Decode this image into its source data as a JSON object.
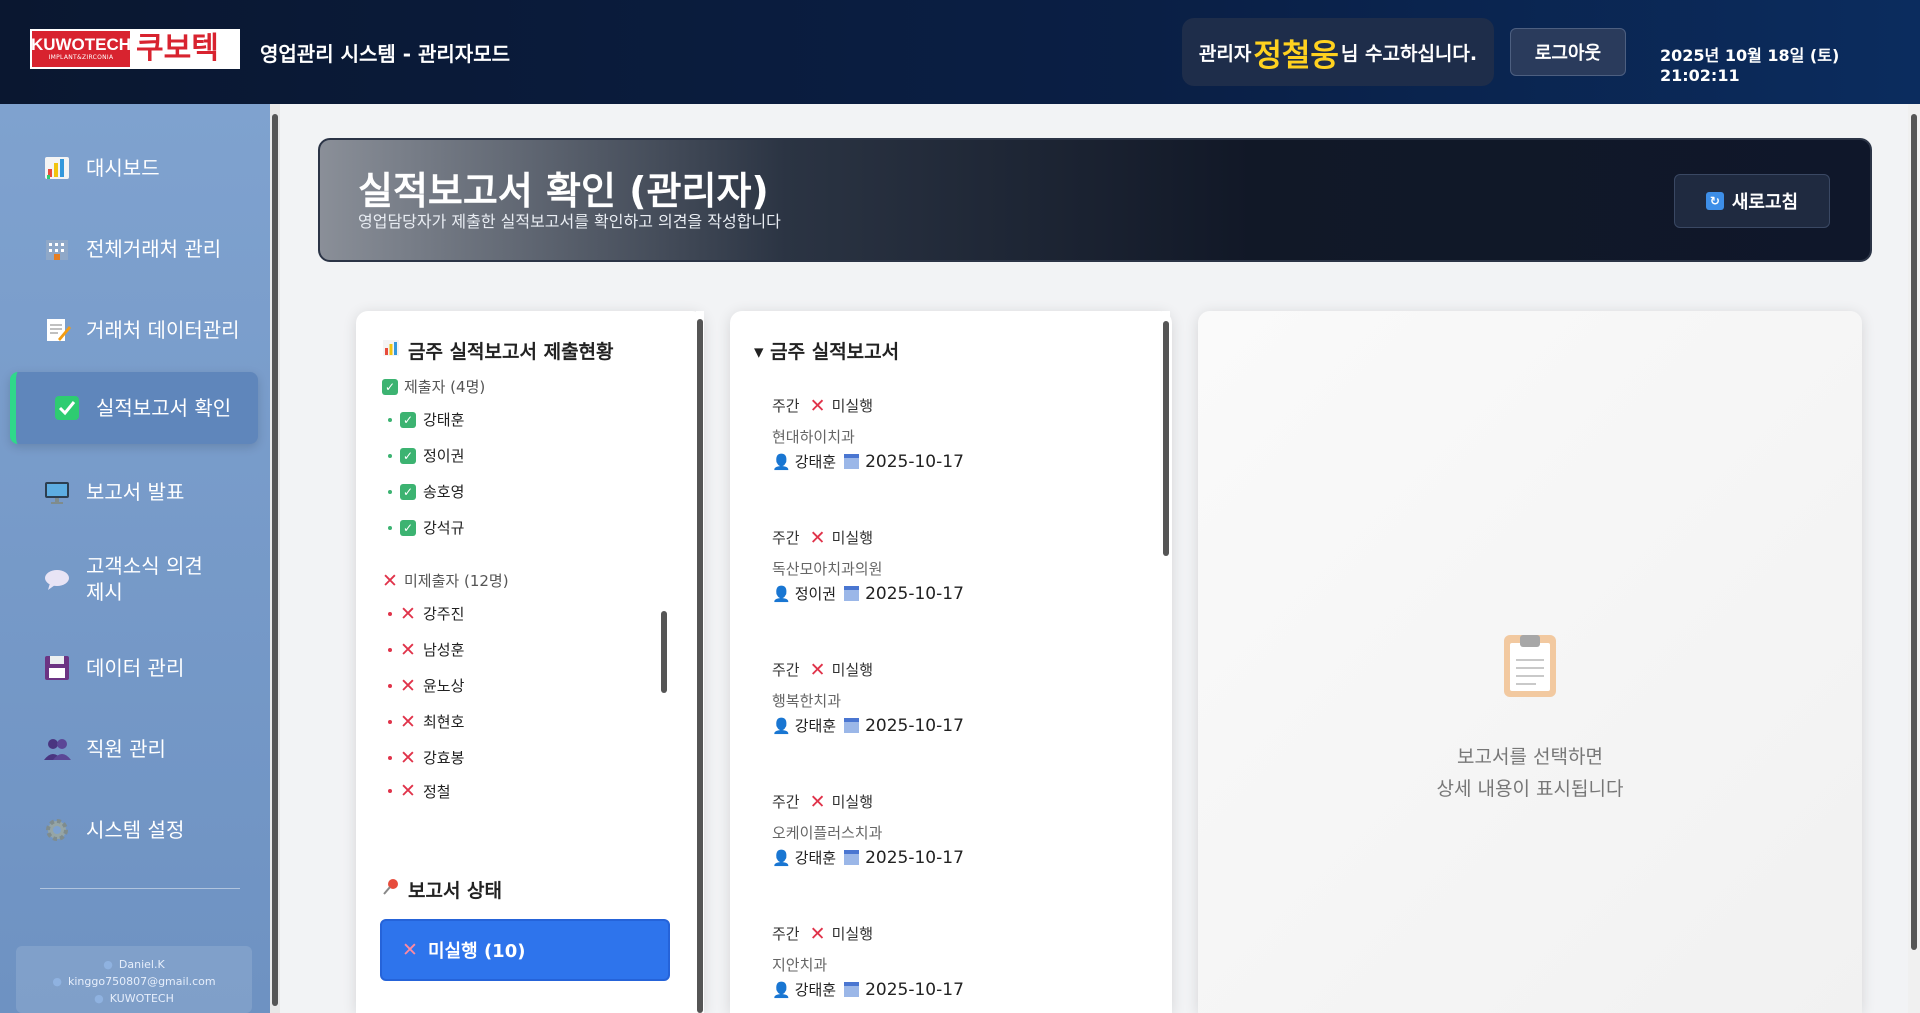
{
  "header": {
    "logo_en": "KUWOTECH",
    "logo_sub": "IMPLANT&ZIRCONIA",
    "logo_ko": "쿠보텍",
    "system_title": "영업관리 시스템 - 관리자모드",
    "welcome_prefix": "관리자",
    "welcome_name": "정철웅",
    "welcome_suffix": "님 수고하십니다.",
    "logout_label": "로그아웃",
    "datetime": "2025년 10월 18일 (토) 21:02:11"
  },
  "sidebar": {
    "items": [
      {
        "label": "대시보드",
        "icon": "chart-icon"
      },
      {
        "label": "전체거래처 관리",
        "icon": "building-icon"
      },
      {
        "label": "거래처 데이터관리",
        "icon": "memo-icon"
      },
      {
        "label": "실적보고서 확인",
        "icon": "check-icon"
      },
      {
        "label": "보고서 발표",
        "icon": "monitor-icon"
      },
      {
        "label": "고객소식 의견 제시",
        "icon": "speech-bubble-icon"
      },
      {
        "label": "데이터 관리",
        "icon": "floppy-icon"
      },
      {
        "label": "직원 관리",
        "icon": "people-icon"
      },
      {
        "label": "시스템 설정",
        "icon": "gear-icon"
      }
    ],
    "footer": {
      "name": "Daniel.K",
      "email": "kinggo750807@gmail.com",
      "company": "KUWOTECH"
    }
  },
  "banner": {
    "title": "실적보고서 확인 (관리자)",
    "subtitle": "영업담당자가 제출한 실적보고서를 확인하고 의견을 작성합니다",
    "refresh_label": "새로고침"
  },
  "submission": {
    "title": "금주 실적보고서 제출현황",
    "submitted_label": "제출자 (4명)",
    "submitted": [
      "강태훈",
      "정이권",
      "송호영",
      "강석규"
    ],
    "not_submitted_label": "미제출자 (12명)",
    "not_submitted": [
      "강주진",
      "남성훈",
      "윤노상",
      "최현호",
      "강효봉",
      "정철"
    ],
    "status_title": "보고서 상태",
    "status_button": "미실행 (10)"
  },
  "reports": {
    "title": "▾ 금주 실적보고서",
    "items": [
      {
        "type": "주간",
        "status": "미실행",
        "client": "현대하이치과",
        "author": "강태훈",
        "date": "2025-10-17"
      },
      {
        "type": "주간",
        "status": "미실행",
        "client": "독산모아치과의원",
        "author": "정이권",
        "date": "2025-10-17"
      },
      {
        "type": "주간",
        "status": "미실행",
        "client": "행복한치과",
        "author": "강태훈",
        "date": "2025-10-17"
      },
      {
        "type": "주간",
        "status": "미실행",
        "client": "오케이플러스치과",
        "author": "강태훈",
        "date": "2025-10-17"
      },
      {
        "type": "주간",
        "status": "미실행",
        "client": "지안치과",
        "author": "강태훈",
        "date": "2025-10-17"
      }
    ]
  },
  "detail": {
    "empty_line1": "보고서를 선택하면",
    "empty_line2": "상세 내용이 표시됩니다"
  },
  "colors": {
    "accent": "#2e74ec",
    "active_bar": "#2fd98a",
    "highlight": "#ffd21f",
    "error": "#e0334a"
  }
}
